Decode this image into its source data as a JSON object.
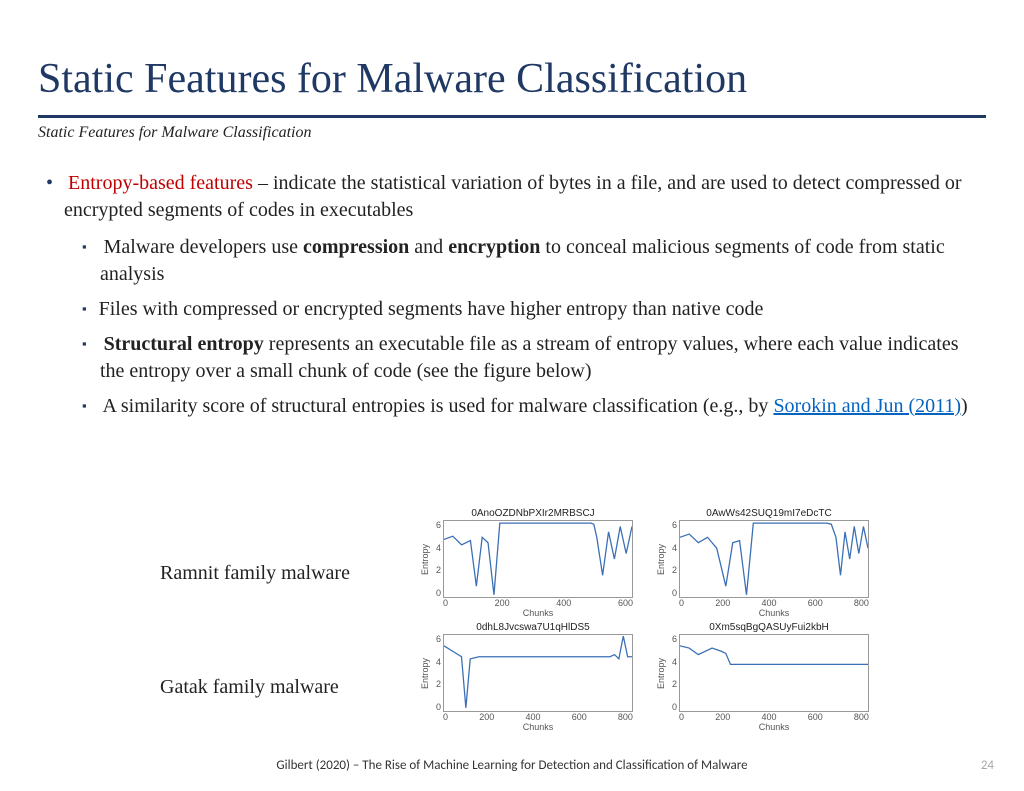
{
  "title": "Static Features for Malware Classification",
  "subtitle": "Static Features for Malware Classification",
  "bullet1": {
    "highlight": "Entropy-based features",
    "rest": " – indicate the statistical variation of bytes in a file, and are used to detect compressed or encrypted segments of codes in executables"
  },
  "sub": [
    {
      "pre": "Malware developers use ",
      "b1": "compression",
      "mid": " and ",
      "b2": "encryption",
      "post": " to conceal malicious segments of code from static analysis"
    },
    {
      "text": "Files with compressed or encrypted segments have higher entropy than native code"
    },
    {
      "b1": "Structural entropy",
      "post": " represents an executable file as a stream of entropy values, where each value indicates the entropy over a small chunk of code (see the figure below)"
    },
    {
      "pre": "A similarity score of structural entropies is used for malware classification (e.g., by ",
      "link": "Sorokin and Jun (2011)",
      "post": ")"
    }
  ],
  "rows": [
    {
      "label": "Ramnit family malware"
    },
    {
      "label": "Gatak family malware"
    }
  ],
  "charts": {
    "ylabel": "Entropy",
    "xlabel": "Chunks",
    "yticks": [
      "6",
      "4",
      "2",
      "0"
    ]
  },
  "chart_data": [
    {
      "type": "line",
      "title": "0AnoOZDNbPXIr2MRBSCJ",
      "xlabel": "Chunks",
      "ylabel": "Entropy",
      "ylim": [
        0,
        7
      ],
      "xlim": [
        0,
        640
      ],
      "xticks": [
        0,
        200,
        400,
        600
      ],
      "series": [
        {
          "name": "entropy",
          "x": [
            0,
            30,
            60,
            90,
            110,
            130,
            150,
            170,
            190,
            210,
            500,
            510,
            520,
            540,
            560,
            580,
            600,
            620,
            640
          ],
          "y": [
            5.3,
            5.6,
            4.8,
            5.2,
            1.0,
            5.5,
            5.0,
            0.2,
            6.8,
            6.8,
            6.8,
            6.7,
            5.5,
            2.0,
            6.0,
            3.5,
            6.5,
            4.0,
            6.5
          ]
        }
      ]
    },
    {
      "type": "line",
      "title": "0AwWs42SUQ19mI7eDcTC",
      "xlabel": "Chunks",
      "ylabel": "Entropy",
      "ylim": [
        0,
        7
      ],
      "xlim": [
        0,
        820
      ],
      "xticks": [
        0,
        200,
        400,
        600,
        800
      ],
      "series": [
        {
          "name": "entropy",
          "x": [
            0,
            40,
            80,
            120,
            160,
            200,
            230,
            260,
            290,
            320,
            640,
            660,
            680,
            700,
            720,
            740,
            760,
            780,
            800,
            820
          ],
          "y": [
            5.5,
            5.8,
            5.0,
            5.5,
            4.5,
            1.0,
            5.0,
            5.2,
            0.2,
            6.8,
            6.8,
            6.7,
            5.5,
            2.0,
            6.0,
            3.5,
            6.5,
            4.0,
            6.5,
            4.5
          ]
        }
      ]
    },
    {
      "type": "line",
      "title": "0dhL8Jvcswa7U1qHlDS5",
      "xlabel": "Chunks",
      "ylabel": "Entropy",
      "ylim": [
        0,
        7
      ],
      "xlim": [
        0,
        860
      ],
      "xticks": [
        0,
        200,
        400,
        600,
        800
      ],
      "series": [
        {
          "name": "entropy",
          "x": [
            0,
            40,
            80,
            100,
            120,
            160,
            200,
            760,
            780,
            800,
            820,
            840,
            860
          ],
          "y": [
            6.0,
            5.5,
            5.0,
            0.3,
            4.8,
            5.0,
            5.0,
            5.0,
            5.2,
            4.8,
            6.9,
            5.0,
            5.0
          ]
        }
      ]
    },
    {
      "type": "line",
      "title": "0Xm5sqBgQASUyFui2kbH",
      "xlabel": "Chunks",
      "ylabel": "Entropy",
      "ylim": [
        0,
        7
      ],
      "xlim": [
        0,
        820
      ],
      "xticks": [
        0,
        200,
        400,
        600,
        800
      ],
      "series": [
        {
          "name": "entropy",
          "x": [
            0,
            40,
            80,
            140,
            180,
            200,
            220,
            800,
            820
          ],
          "y": [
            6.0,
            5.8,
            5.2,
            5.8,
            5.5,
            5.3,
            4.3,
            4.3,
            4.3
          ]
        }
      ]
    }
  ],
  "footer": "Gilbert (2020) – The Rise of Machine Learning for Detection and Classification of Malware",
  "pagenum": "24"
}
